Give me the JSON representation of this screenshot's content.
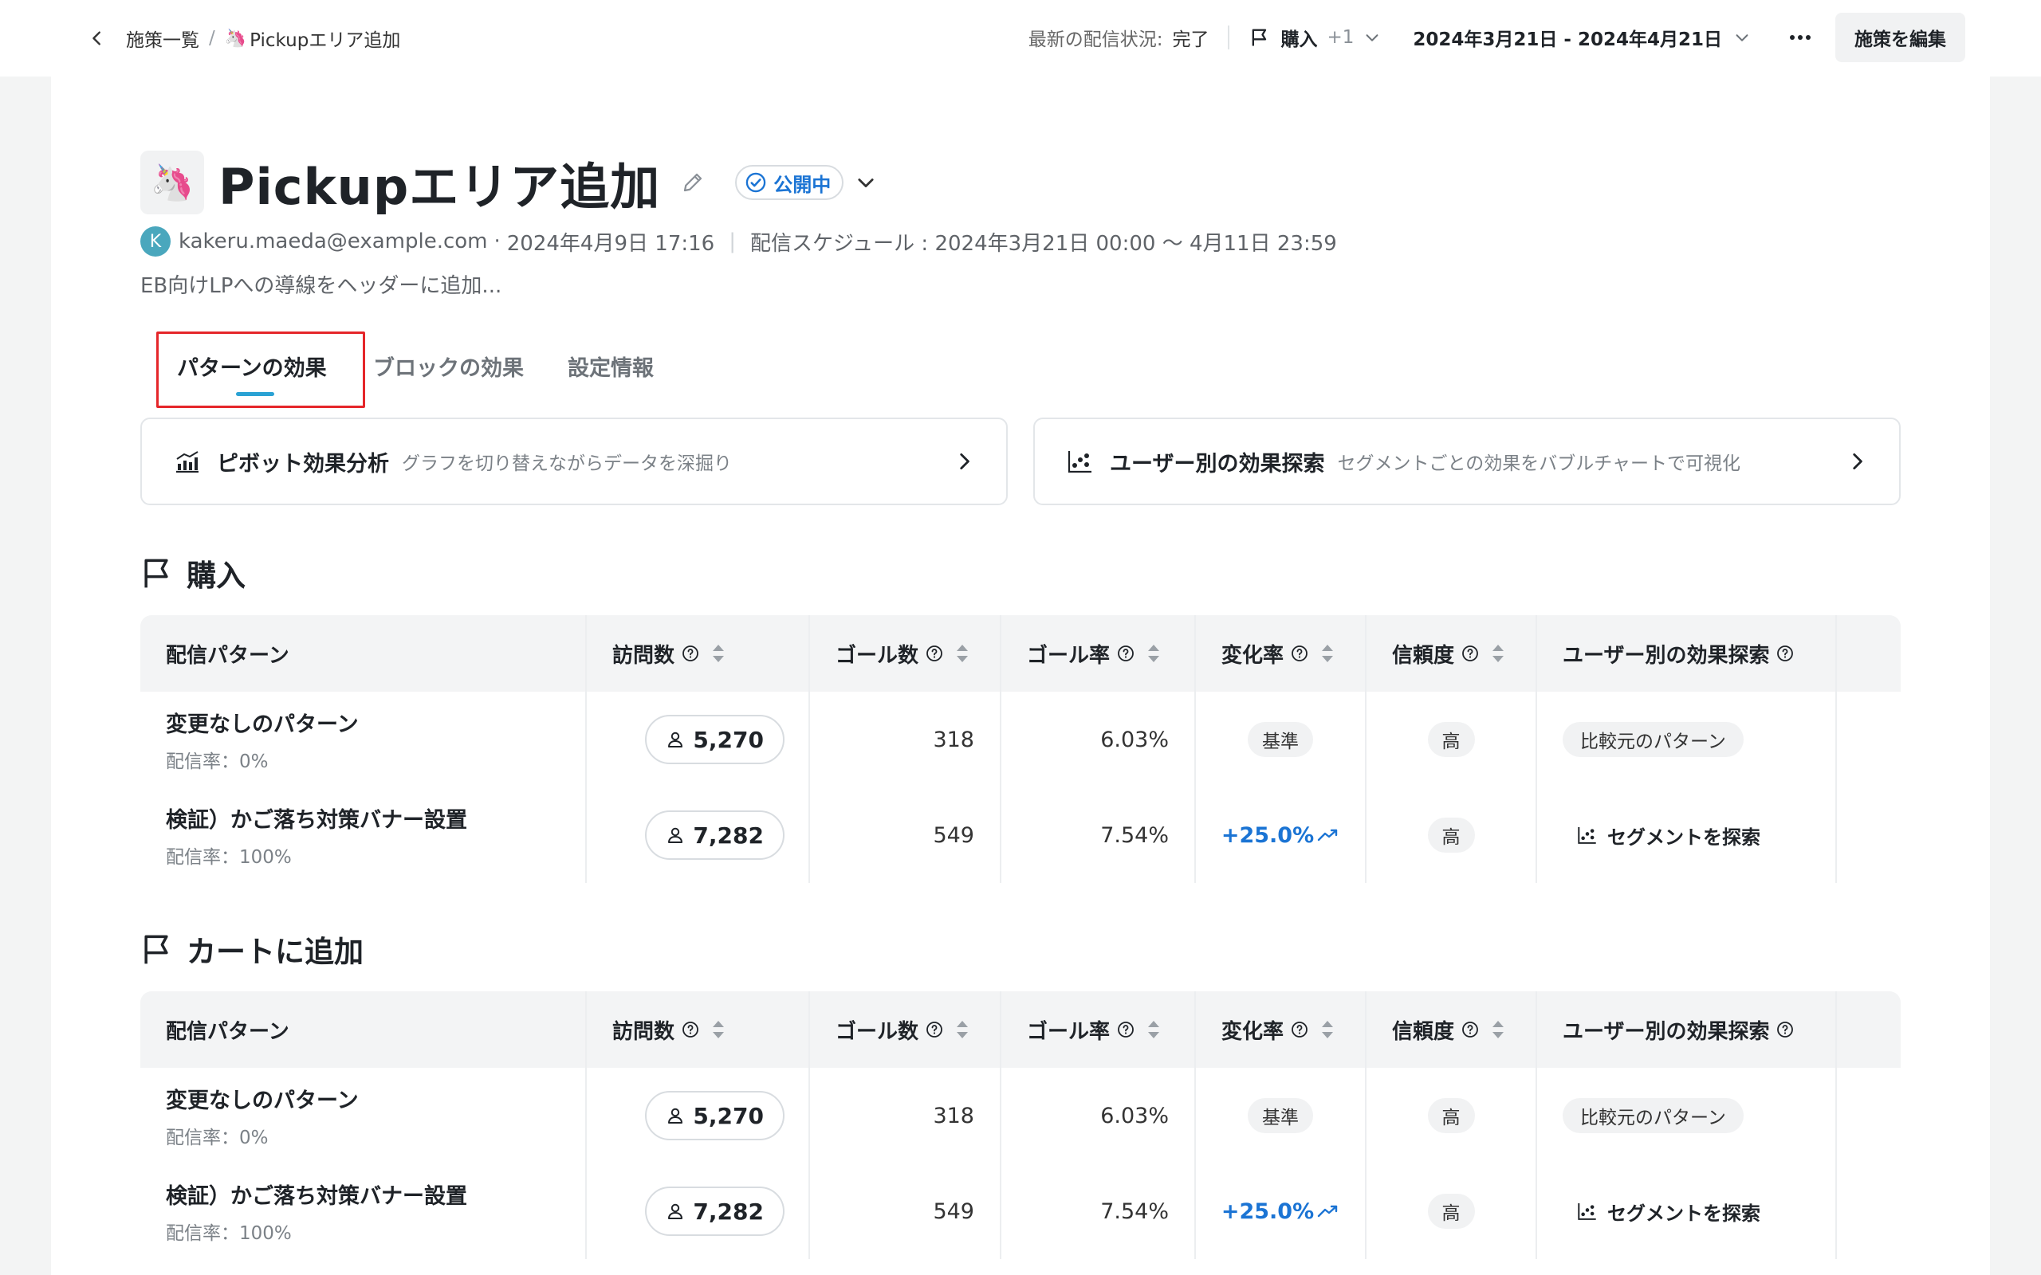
{
  "breadcrumb": {
    "parent": "施策一覧",
    "separator": "/",
    "current_emoji": "🦄",
    "current": "Pickupエリア追加"
  },
  "topbar": {
    "status_label": "最新の配信状況:",
    "status_value": "完了",
    "goal_label": "購入",
    "goal_extra": "+1",
    "date_range": "2024年3月21日 - 2024年4月21日",
    "more": "•••",
    "edit_button": "施策を編集"
  },
  "header": {
    "emoji": "🦄",
    "title": "Pickupエリア追加",
    "status_badge": "公開中",
    "avatar_initial": "K",
    "author": "kakeru.maeda@example.com",
    "dot": "·",
    "created_at": "2024年4月9日 17:16",
    "meta_sep": "|",
    "schedule": "配信スケジュール : 2024年3月21日 00:00 〜 4月11日 23:59",
    "description": "EB向けLPへの導線をヘッダーに追加..."
  },
  "tabs": [
    {
      "label": "パターンの効果",
      "active": true
    },
    {
      "label": "ブロックの効果",
      "active": false
    },
    {
      "label": "設定情報",
      "active": false
    }
  ],
  "cards": [
    {
      "title": "ピボット効果分析",
      "subtitle": "グラフを切り替えながらデータを深掘り",
      "icon": "bar-chart-icon"
    },
    {
      "title": "ユーザー別の効果探索",
      "subtitle": "セグメントごとの効果をバブルチャートで可視化",
      "icon": "scatter-chart-icon"
    }
  ],
  "columns": {
    "pattern": "配信パターン",
    "visits": "訪問数",
    "goals": "ゴール数",
    "goal_rate": "ゴール率",
    "change": "変化率",
    "confidence": "信頼度",
    "explore": "ユーザー別の効果探索"
  },
  "sections": [
    {
      "title": "購入",
      "rows": [
        {
          "name": "変更なしのパターン",
          "rate": "配信率：0%",
          "visits": "5,270",
          "goals": "318",
          "goal_rate": "6.03%",
          "change": "基準",
          "confidence": "高",
          "explore": "比較元のパターン"
        },
        {
          "name": "検証）かご落ち対策バナー設置",
          "rate": "配信率：100%",
          "visits": "7,282",
          "goals": "549",
          "goal_rate": "7.54%",
          "change": "+25.0%",
          "confidence": "高",
          "explore": "セグメントを探索"
        }
      ]
    },
    {
      "title": "カートに追加",
      "rows": [
        {
          "name": "変更なしのパターン",
          "rate": "配信率：0%",
          "visits": "5,270",
          "goals": "318",
          "goal_rate": "6.03%",
          "change": "基準",
          "confidence": "高",
          "explore": "比較元のパターン"
        },
        {
          "name": "検証）かご落ち対策バナー設置",
          "rate": "配信率：100%",
          "visits": "7,282",
          "goals": "549",
          "goal_rate": "7.54%",
          "change": "+25.0%",
          "confidence": "高",
          "explore": "セグメントを探索"
        }
      ]
    }
  ],
  "colors": {
    "accent_blue": "#1b74d4",
    "tab_underline": "#2aa2d4",
    "highlight_red": "#e5262a",
    "avatar": "#4aa7bd"
  }
}
